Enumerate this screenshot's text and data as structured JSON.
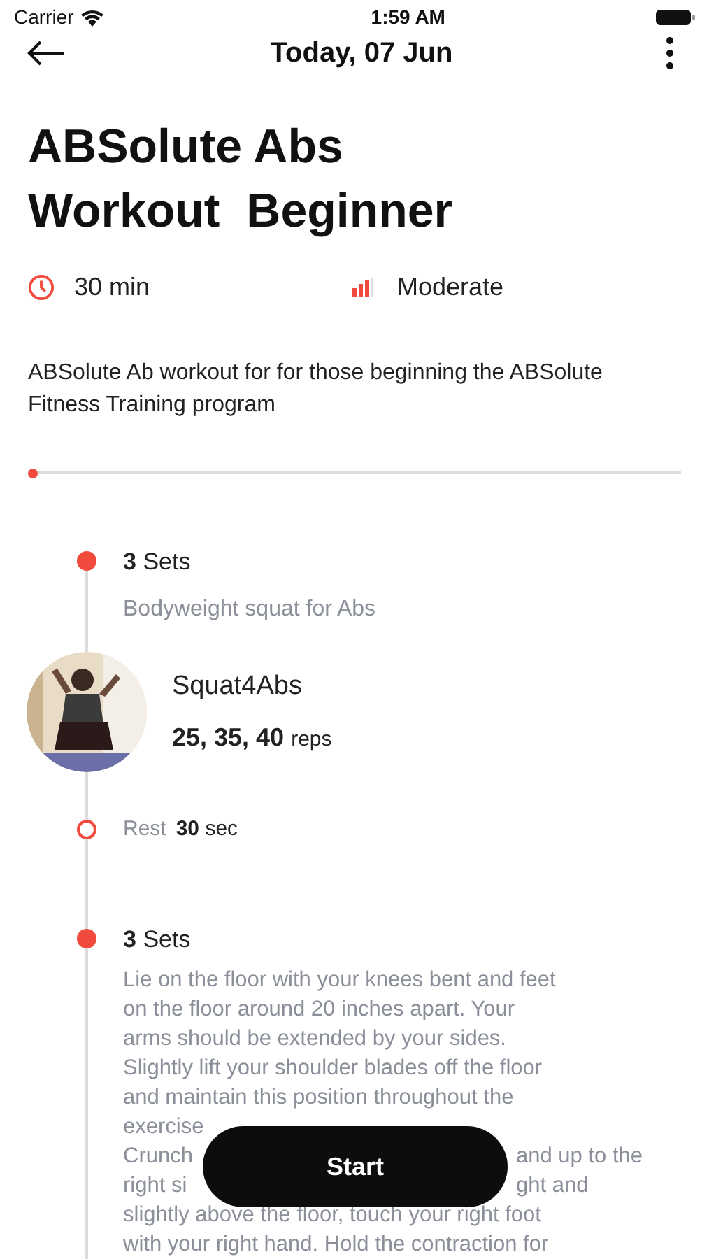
{
  "status_bar": {
    "carrier": "Carrier",
    "time": "1:59 AM"
  },
  "header": {
    "title": "Today, 07 Jun"
  },
  "workout": {
    "title_lines": [
      "ABSolute Abs",
      "Workout  Beginner"
    ],
    "duration": "30 min",
    "difficulty": "Moderate",
    "description": "ABSolute Ab workout for for those beginning the ABSolute Fitness Training program",
    "progress": {
      "level": 0
    }
  },
  "steps": [
    {
      "kind": "set",
      "sets_count": "3",
      "sets_label": "Sets",
      "subtitle": "Bodyweight squat for Abs",
      "exercise": {
        "name": "Squat4Abs",
        "reps": "25, 35, 40",
        "reps_unit": "reps"
      }
    },
    {
      "kind": "rest",
      "label": "Rest",
      "value": "30 sec"
    },
    {
      "kind": "set",
      "sets_count": "3",
      "sets_label": "Sets",
      "description_lines": [
        [
          "Lie on the floor with your knees bent and feet"
        ],
        [
          "on the floor around 20 inches apart. Your"
        ],
        [
          "arms should be extended by your sides."
        ],
        [
          "Slightly lift your shoulder blades off the floor"
        ],
        [
          "and maintain this position throughout the"
        ],
        [
          "exercise"
        ],
        [
          "Crunch",
          "and up to the"
        ],
        [
          "right si",
          "ght and"
        ],
        [
          "slightly above the floor, touch your right foot"
        ],
        [
          "with your right hand. Hold the contraction for"
        ]
      ]
    }
  ],
  "start_button": {
    "label": "Start"
  }
}
